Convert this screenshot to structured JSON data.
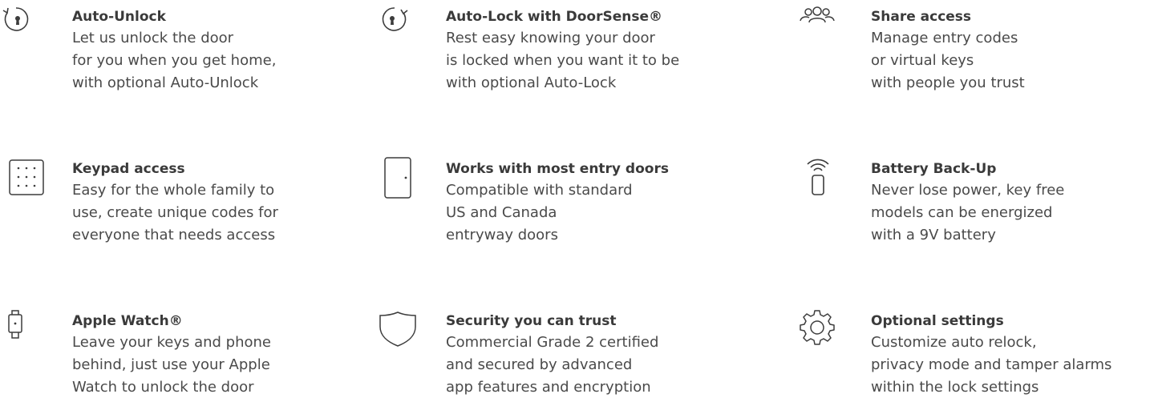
{
  "features": [
    {
      "icon": "auto-unlock-icon",
      "title": "Auto-Unlock",
      "lines": [
        "Let us unlock the door",
        "for you when you get home,",
        "with optional Auto-Unlock"
      ]
    },
    {
      "icon": "auto-lock-icon",
      "title": "Auto-Lock with DoorSense®",
      "lines": [
        "Rest easy knowing your door",
        "is locked when you want it to be",
        "with optional Auto-Lock"
      ]
    },
    {
      "icon": "people-icon",
      "title": "Share access",
      "lines": [
        "Manage entry codes",
        "or virtual keys",
        "with people you trust"
      ]
    },
    {
      "icon": "keypad-icon",
      "title": "Keypad access",
      "lines": [
        "Easy for the whole family to",
        "use, create unique codes for",
        "everyone that needs access"
      ]
    },
    {
      "icon": "door-icon",
      "title": "Works with most entry doors",
      "lines": [
        "Compatible with standard",
        "US and Canada",
        "entryway doors"
      ]
    },
    {
      "icon": "battery-icon",
      "title": "Battery Back-Up",
      "lines": [
        "Never lose power, key free",
        "models can be energized",
        "with a 9V battery"
      ]
    },
    {
      "icon": "watch-icon",
      "title": "Apple Watch®",
      "lines": [
        "Leave your keys and phone",
        "behind, just use your Apple",
        "Watch to unlock the door"
      ]
    },
    {
      "icon": "shield-icon",
      "title": "Security you can trust",
      "lines": [
        "Commercial Grade 2 certified",
        "and secured by advanced",
        "app features and encryption"
      ]
    },
    {
      "icon": "gear-icon",
      "title": "Optional settings",
      "lines": [
        "Customize auto relock,",
        "privacy mode and tamper alarms",
        "within the lock settings"
      ]
    }
  ]
}
